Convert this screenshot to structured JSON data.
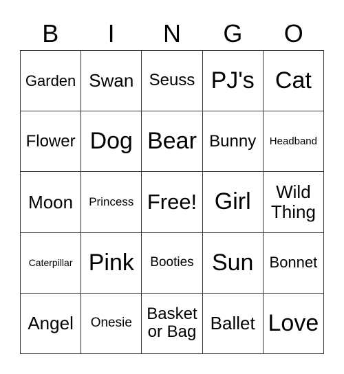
{
  "header": {
    "letters": [
      "B",
      "I",
      "N",
      "G",
      "O"
    ]
  },
  "grid": {
    "rows": [
      [
        "Garden",
        "Swan",
        "Seuss",
        "PJ's",
        "Cat"
      ],
      [
        "Flower",
        "Dog",
        "Bear",
        "Bunny",
        "Headband"
      ],
      [
        "Moon",
        "Princess",
        "Free!",
        "Girl",
        "Wild Thing"
      ],
      [
        "Caterpillar",
        "Pink",
        "Booties",
        "Sun",
        "Bonnet"
      ],
      [
        "Angel",
        "Onesie",
        "Basket or Bag",
        "Ballet",
        "Love"
      ]
    ]
  }
}
